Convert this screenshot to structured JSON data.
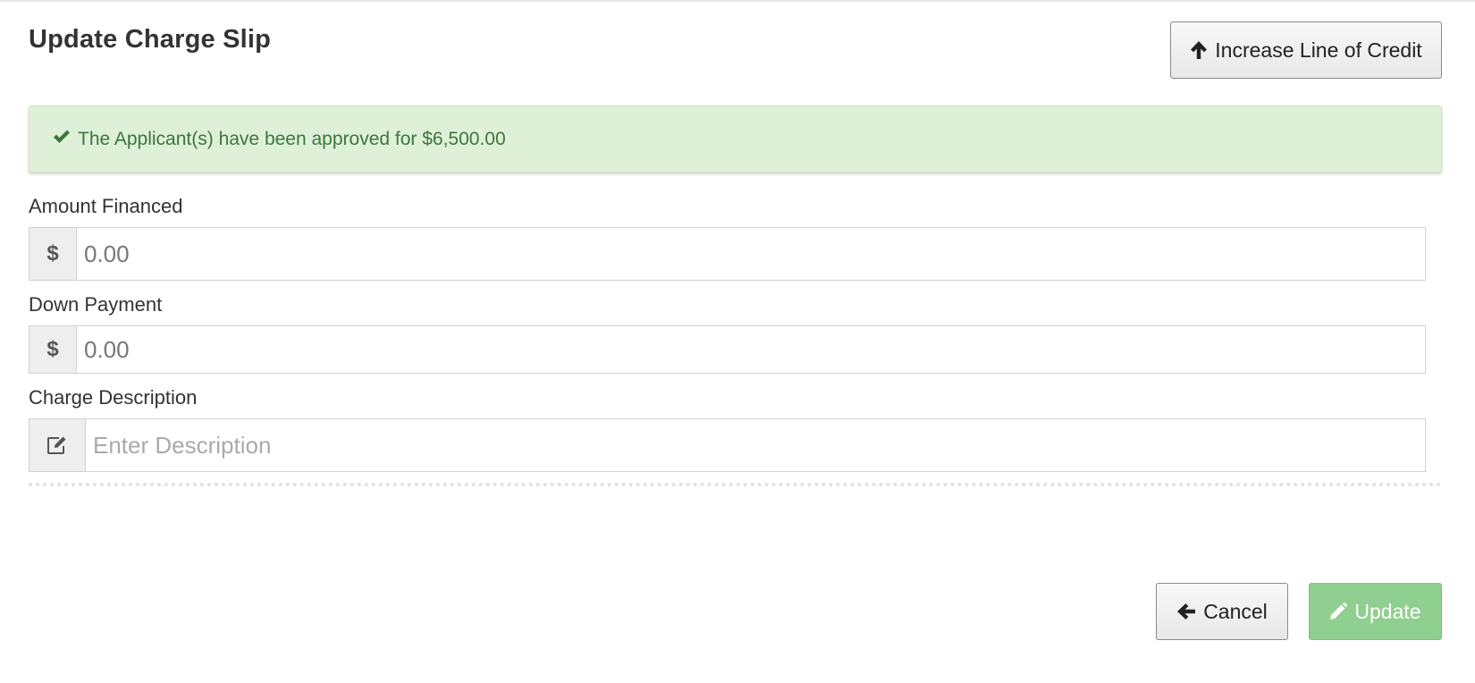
{
  "page": {
    "title": "Update Charge Slip"
  },
  "header": {
    "increase_credit_label": "Increase Line of Credit",
    "increase_credit_icon": "arrow-up-icon"
  },
  "alert": {
    "icon": "check-icon",
    "message": "The Applicant(s) have been approved for $6,500.00",
    "color": "#3c763d",
    "background": "#dff0d8"
  },
  "form": {
    "amount_financed": {
      "label": "Amount Financed",
      "addon": "$",
      "value": "",
      "placeholder": "0.00"
    },
    "down_payment": {
      "label": "Down Payment",
      "addon": "$",
      "value": "",
      "placeholder": "0.00"
    },
    "charge_description": {
      "label": "Charge Description",
      "addon_icon": "edit-icon",
      "value": "",
      "placeholder": "Enter Description"
    }
  },
  "footer": {
    "cancel_label": "Cancel",
    "cancel_icon": "arrow-left-icon",
    "update_label": "Update",
    "update_icon": "pencil-icon",
    "update_color": "#8fcf8f"
  }
}
